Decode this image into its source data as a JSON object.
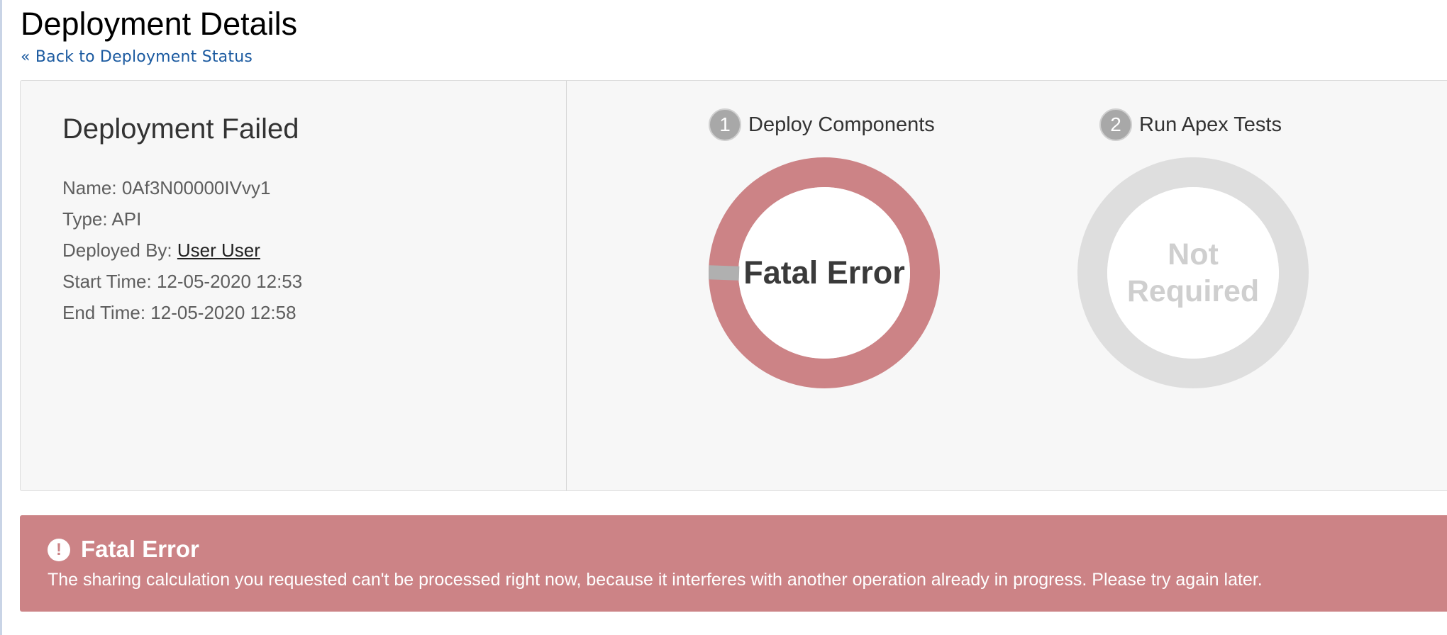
{
  "page": {
    "title": "Deployment Details",
    "back_link": "« Back to Deployment Status"
  },
  "summary": {
    "status": "Deployment Failed",
    "name_label": "Name:",
    "name_value": "0Af3N00000IVvy1",
    "type_label": "Type:",
    "type_value": "API",
    "deployed_by_label": "Deployed By:",
    "deployed_by_value": "User User",
    "start_time_label": "Start Time:",
    "start_time_value": "12-05-2020 12:53",
    "end_time_label": "End Time:",
    "end_time_value": "12-05-2020 12:58"
  },
  "steps": [
    {
      "number": "1",
      "label": "Deploy Components",
      "status_text": "Fatal Error",
      "ring_color": "#cc8386",
      "progress_fraction_complete": 0.0,
      "indicator_color": "#b0b0b0"
    },
    {
      "number": "2",
      "label": "Run Apex Tests",
      "status_line1": "Not",
      "status_line2": "Required",
      "ring_color": "#dedede"
    }
  ],
  "error": {
    "icon": "exclamation-circle-icon",
    "title": "Fatal Error",
    "message": "The sharing calculation you requested can't be processed right now, because it interferes with another operation already in progress. Please try again later."
  },
  "colors": {
    "link": "#1b5aa0",
    "error_background": "#cc8386",
    "panel_background": "#f7f7f7",
    "badge": "#a8a8a8"
  }
}
